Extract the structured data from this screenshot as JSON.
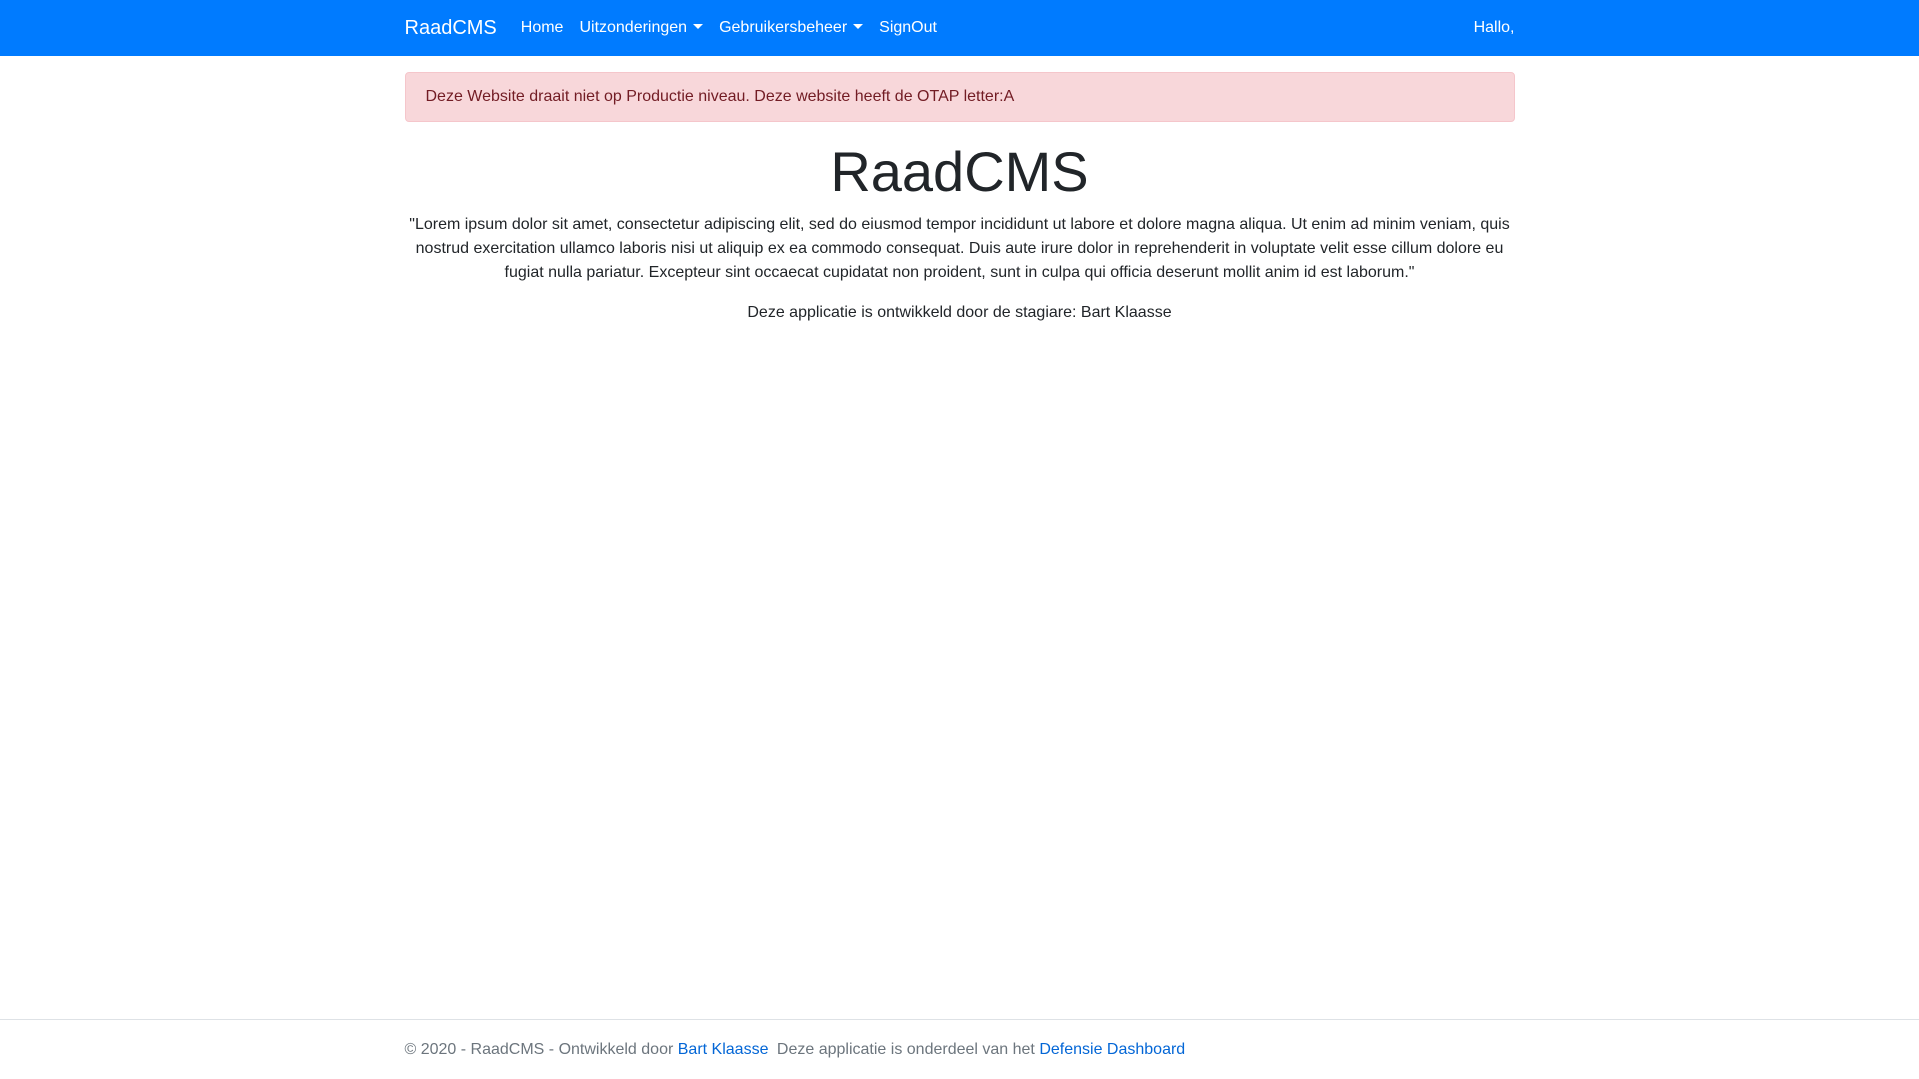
{
  "navbar": {
    "brand": "RaadCMS",
    "items": [
      {
        "label": "Home",
        "dropdown": false
      },
      {
        "label": "Uitzonderingen",
        "dropdown": true
      },
      {
        "label": "Gebruikersbeheer",
        "dropdown": true
      },
      {
        "label": "SignOut",
        "dropdown": false
      }
    ],
    "greeting": "Hallo,"
  },
  "alert": {
    "text": "Deze Website draait niet op Productie niveau. Deze website heeft de OTAP letter:A"
  },
  "main": {
    "title": "RaadCMS",
    "intro": "\"Lorem ipsum dolor sit amet, consectetur adipiscing elit, sed do eiusmod tempor incididunt ut labore et dolore magna aliqua. Ut enim ad minim veniam, quis nostrud exercitation ullamco laboris nisi ut aliquip ex ea commodo consequat. Duis aute irure dolor in reprehenderit in voluptate velit esse cillum dolore eu fugiat nulla pariatur. Excepteur sint occaecat cupidatat non proident, sunt in culpa qui officia deserunt mollit anim id est laborum.\"",
    "credit": "Deze applicatie is ontwikkeld door de stagiare: Bart Klaasse"
  },
  "footer": {
    "prefix": "© 2020 - RaadCMS - Ontwikkeld door",
    "author_link": "Bart Klaasse",
    "middle": "Deze applicatie is onderdeel van het",
    "dashboard_link": "Defensie Dashboard"
  },
  "colors": {
    "navbar_bg": "#007bff",
    "alert_bg": "#f8d7da",
    "alert_border": "#f5c6cb",
    "alert_text": "#721c24",
    "link": "#0366d6",
    "muted": "#6c757d"
  }
}
